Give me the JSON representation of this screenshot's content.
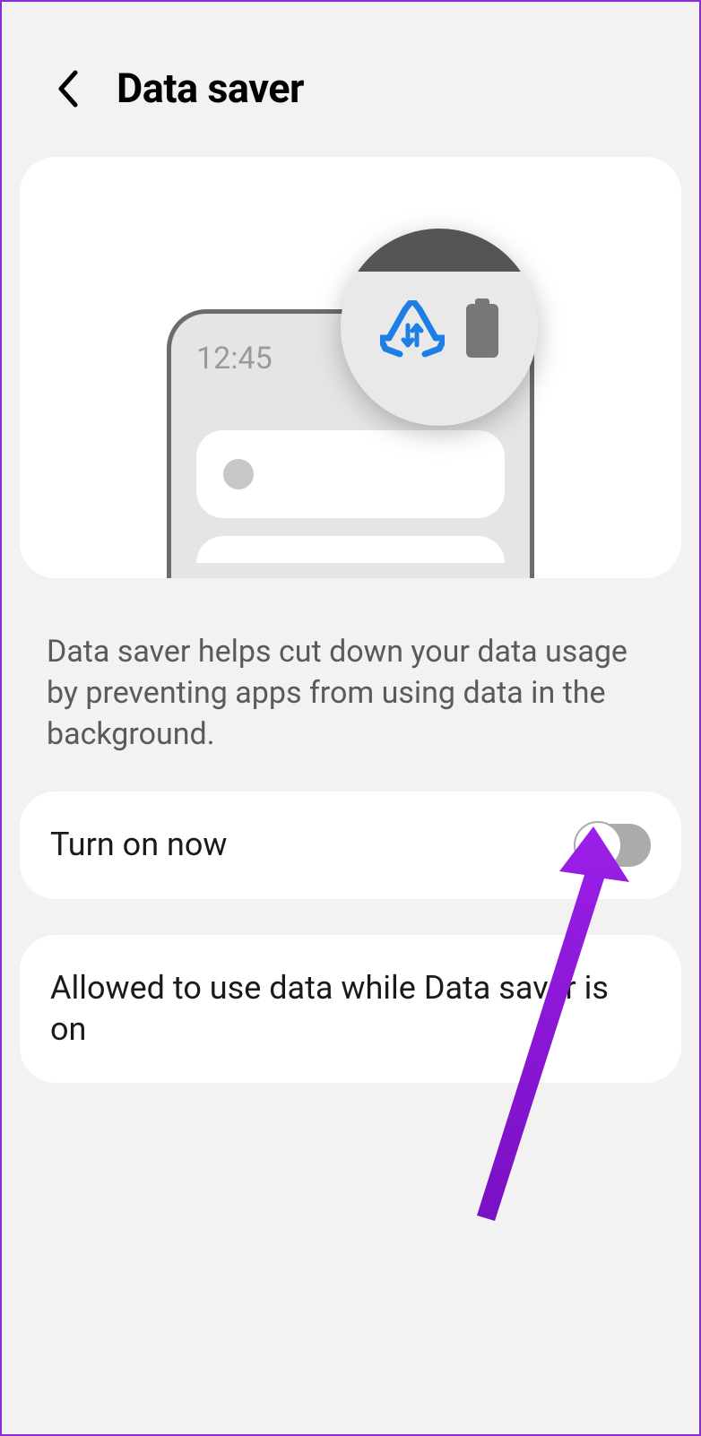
{
  "header": {
    "title": "Data saver"
  },
  "illustration": {
    "time": "12:45"
  },
  "description": "Data saver helps cut down your data usage by preventing apps from using data in the background.",
  "settings": {
    "toggle": {
      "label": "Turn on now",
      "state": "off"
    },
    "allowed": {
      "label": "Allowed to use data while Data saver is on"
    }
  },
  "colors": {
    "accent_icon": "#1d7fe6",
    "annotation": "#8b17d1"
  }
}
